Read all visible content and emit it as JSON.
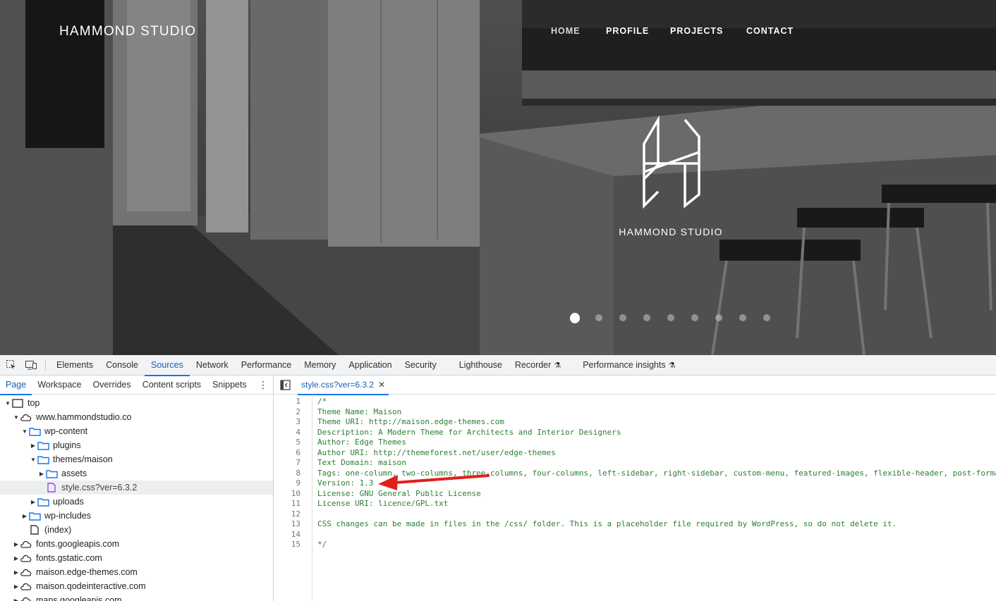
{
  "hero": {
    "brand": "HAMMOND STUDIO",
    "nav": [
      "HOME",
      "PROFILE",
      "PROJECTS",
      "CONTACT"
    ],
    "logo_text": "HAMMOND STUDIO",
    "slider": {
      "count": 9,
      "active_index": 0
    }
  },
  "devtools": {
    "main_tabs": [
      "Elements",
      "Console",
      "Sources",
      "Network",
      "Performance",
      "Memory",
      "Application",
      "Security",
      "Lighthouse",
      "Recorder",
      "Performance insights"
    ],
    "active_main_tab": "Sources",
    "sub_tabs": [
      "Page",
      "Workspace",
      "Overrides",
      "Content scripts",
      "Snippets"
    ],
    "active_sub_tab": "Page",
    "tree": [
      {
        "label": "top",
        "icon": "frame-icon",
        "expanded": true,
        "depth": 0
      },
      {
        "label": "www.hammondstudio.co",
        "icon": "cloud-icon",
        "expanded": true,
        "depth": 1
      },
      {
        "label": "wp-content",
        "icon": "folder-icon",
        "expanded": true,
        "depth": 2
      },
      {
        "label": "plugins",
        "icon": "folder-icon",
        "expanded": false,
        "depth": 3
      },
      {
        "label": "themes/maison",
        "icon": "folder-icon",
        "expanded": true,
        "depth": 3
      },
      {
        "label": "assets",
        "icon": "folder-icon",
        "expanded": false,
        "depth": 4
      },
      {
        "label": "style.css?ver=6.3.2",
        "icon": "file-css-icon",
        "selected": true,
        "depth": 4
      },
      {
        "label": "uploads",
        "icon": "folder-icon",
        "expanded": false,
        "depth": 3
      },
      {
        "label": "wp-includes",
        "icon": "folder-icon",
        "expanded": false,
        "depth": 2
      },
      {
        "label": "(index)",
        "icon": "file-icon",
        "depth": 2
      },
      {
        "label": "fonts.googleapis.com",
        "icon": "cloud-icon",
        "expanded": false,
        "depth": 1
      },
      {
        "label": "fonts.gstatic.com",
        "icon": "cloud-icon",
        "expanded": false,
        "depth": 1
      },
      {
        "label": "maison.edge-themes.com",
        "icon": "cloud-icon",
        "expanded": false,
        "depth": 1
      },
      {
        "label": "maison.qodeinteractive.com",
        "icon": "cloud-icon",
        "expanded": false,
        "depth": 1
      },
      {
        "label": "maps.googleapis.com",
        "icon": "cloud-icon",
        "expanded": false,
        "depth": 1
      }
    ],
    "open_file": "style.css?ver=6.3.2",
    "code_lines": [
      "/*",
      "Theme Name: Maison",
      "Theme URI: http://maison.edge-themes.com",
      "Description: A Modern Theme for Architects and Interior Designers",
      "Author: Edge Themes",
      "Author URI: http://themeforest.net/user/edge-themes",
      "Text Domain: maison",
      "Tags: one-column, two-columns, three-columns, four-columns, left-sidebar, right-sidebar, custom-menu, featured-images, flexible-header, post-forma",
      "Version: 1.3",
      "License: GNU General Public License",
      "License URI: licence/GPL.txt",
      "",
      "CSS changes can be made in files in the /css/ folder. This is a placeholder file required by WordPress, so do not delete it.",
      "",
      "*/"
    ],
    "line_numbers": [
      "1",
      "2",
      "3",
      "4",
      "5",
      "6",
      "7",
      "8",
      "9",
      "10",
      "11",
      "12",
      "13",
      "14",
      "15"
    ],
    "annotation": {
      "color": "#e0201b",
      "points_to_line": 9
    }
  }
}
